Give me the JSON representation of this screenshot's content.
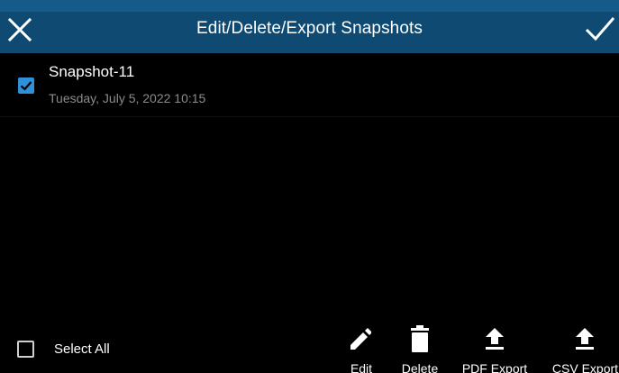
{
  "header": {
    "title": "Edit/Delete/Export Snapshots",
    "close_icon": "close-icon",
    "confirm_icon": "checkmark-icon",
    "background_color": "#0f4a72"
  },
  "snapshots": [
    {
      "name": "Snapshot-11",
      "date": "Tuesday, July 5, 2022 10:15",
      "checked": true
    }
  ],
  "footer": {
    "select_all": {
      "label": "Select All",
      "checked": false
    },
    "actions": [
      {
        "label": "Edit",
        "icon": "pencil-icon"
      },
      {
        "label": "Delete",
        "icon": "trash-icon"
      },
      {
        "label": "PDF Export",
        "icon": "upload-icon"
      },
      {
        "label": "CSV Export",
        "icon": "upload-icon"
      }
    ]
  },
  "colors": {
    "accent": "#2f90d8",
    "secondary_text": "#8b8b8b"
  }
}
